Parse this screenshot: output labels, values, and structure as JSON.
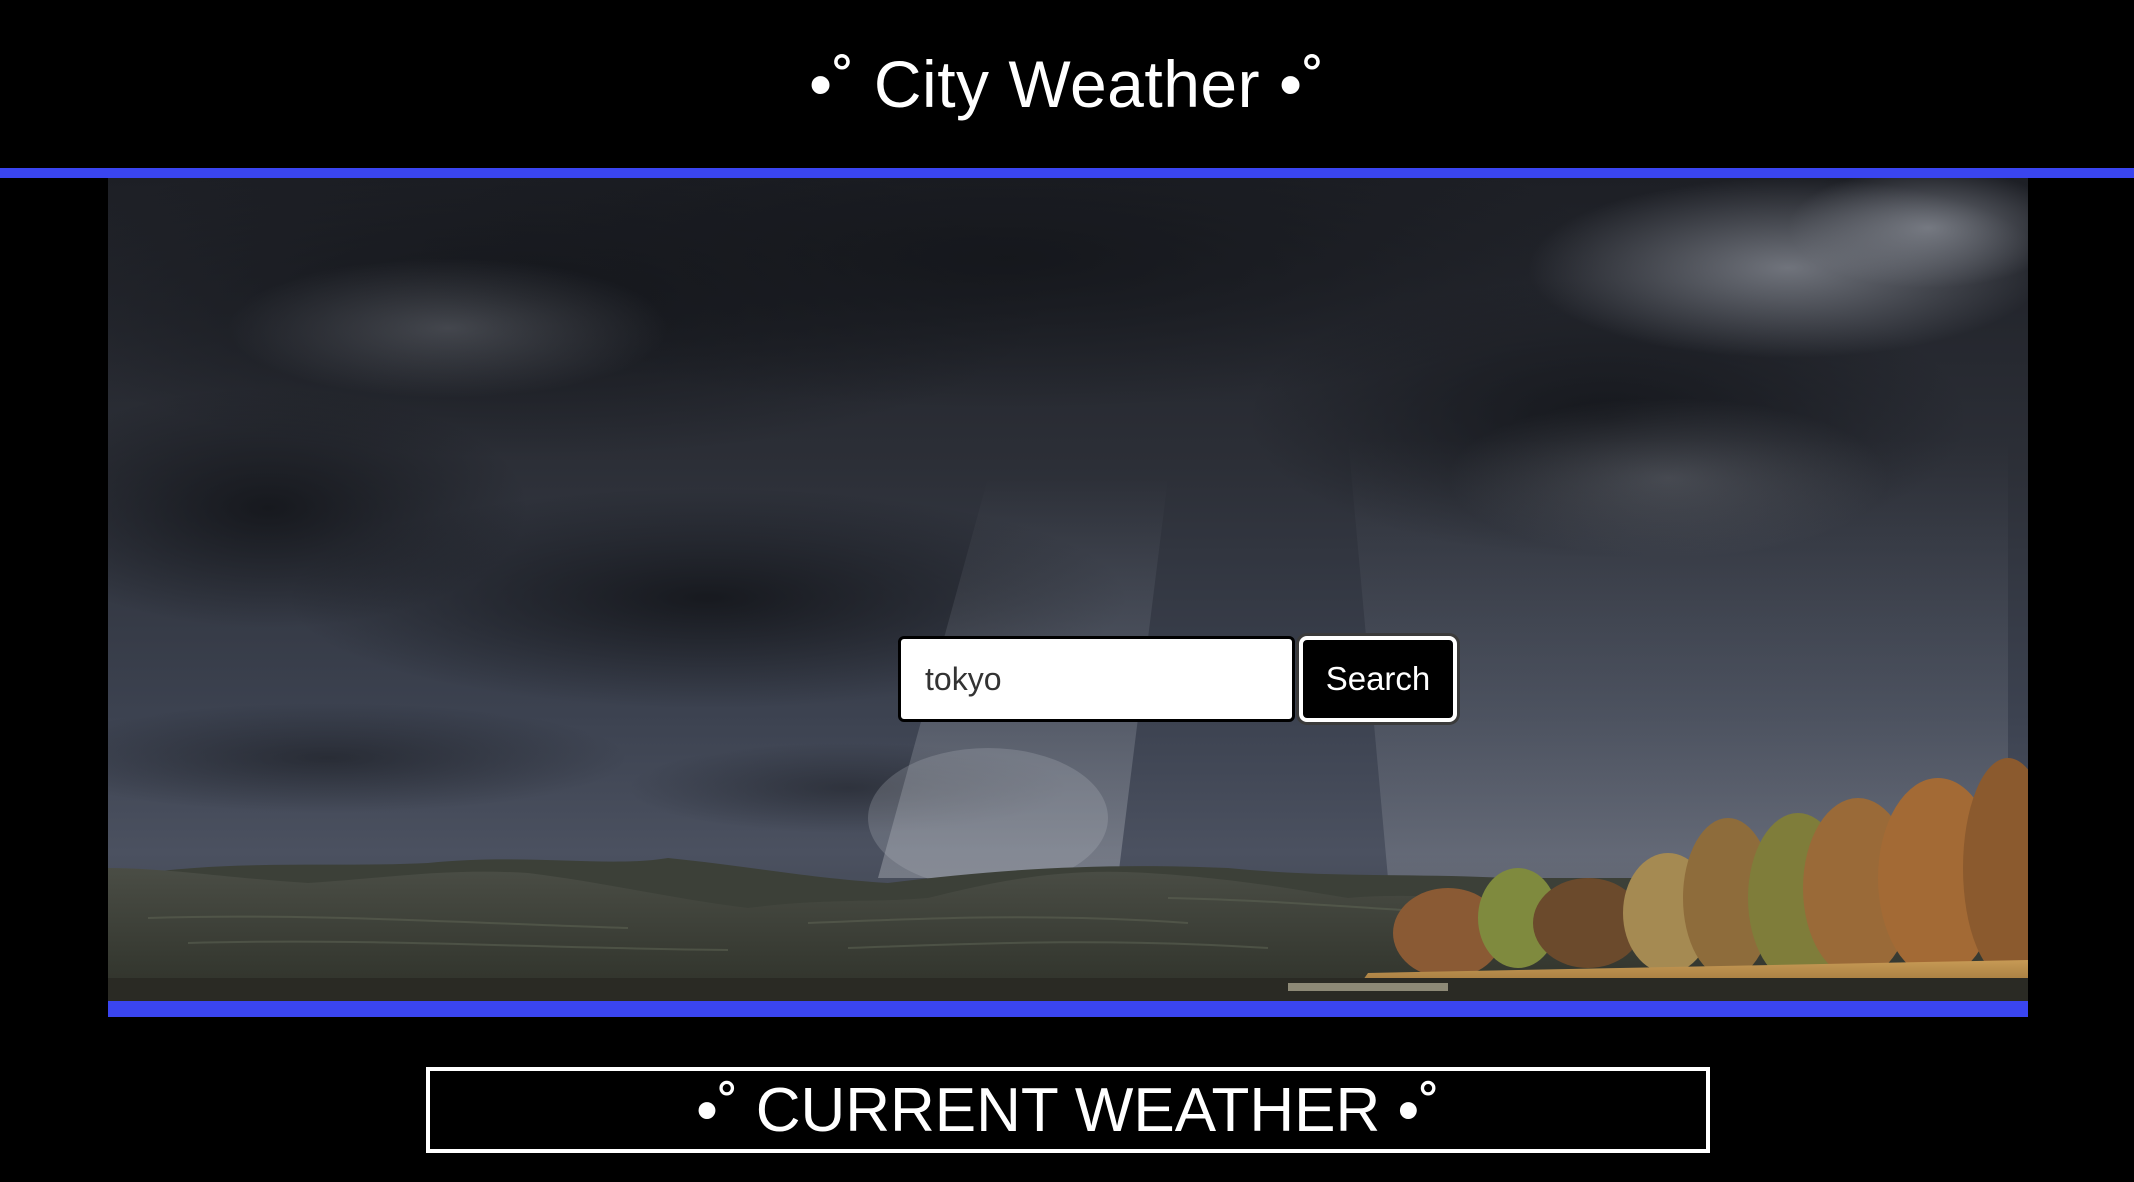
{
  "header": {
    "title": "•˚ City Weather •˚"
  },
  "search": {
    "value": "tokyo",
    "button_label": "Search"
  },
  "current_weather": {
    "heading": "•˚ CURRENT WEATHER •˚"
  },
  "colors": {
    "accent": "#3a45f0",
    "background": "#000000",
    "text": "#ffffff"
  }
}
